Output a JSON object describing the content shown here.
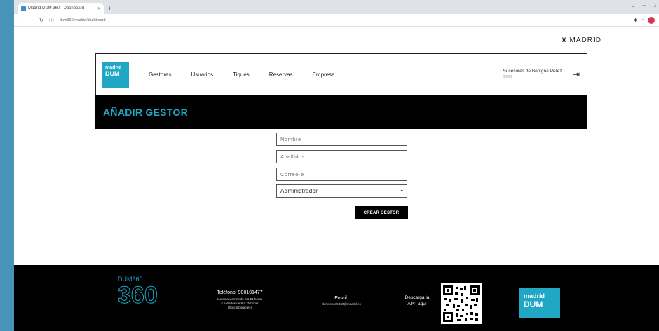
{
  "browser": {
    "tab_title": "Madrid DUM 360 · Dashboard",
    "tab_close": "✕",
    "new_tab": "+",
    "url": "dum360.madrid/dashboard",
    "window_controls": [
      "⌄",
      "–",
      "□"
    ]
  },
  "header": {
    "brand": "MADRID",
    "logo_line1": "madrid",
    "logo_line2": "DUM"
  },
  "nav": {
    "items": [
      "Gestores",
      "Usuarios",
      "Tiques",
      "Reservas",
      "Empresa"
    ]
  },
  "user": {
    "name": "Sucesores de Benigna Perez...",
    "sub": "00001"
  },
  "page": {
    "title": "AÑADIR GESTOR"
  },
  "form": {
    "nombre_placeholder": "Nombre",
    "apellidos_placeholder": "Apellidos",
    "correo_placeholder": "Correo-e",
    "role_selected": "Administrador",
    "submit_label": "CREAR GESTOR"
  },
  "footer": {
    "logo_text": "DUM360",
    "logo_number": "360",
    "phone": "Teléfono: 900101477",
    "hours_1": "Lunes a viernes de 8 a 21 horas",
    "hours_2": "y sábados de 8 a 15 horas",
    "hours_3": "(Solo laborables)",
    "email_label": "Email:",
    "email_value": "dumsoporte360@madrid.es",
    "app_line1": "Descarga la",
    "app_line2": "APP aquí",
    "madrid_logo_line1": "madrid",
    "madrid_logo_line2": "DUM"
  },
  "colors": {
    "accent": "#1fa7c4",
    "background": "#4a93b8"
  }
}
